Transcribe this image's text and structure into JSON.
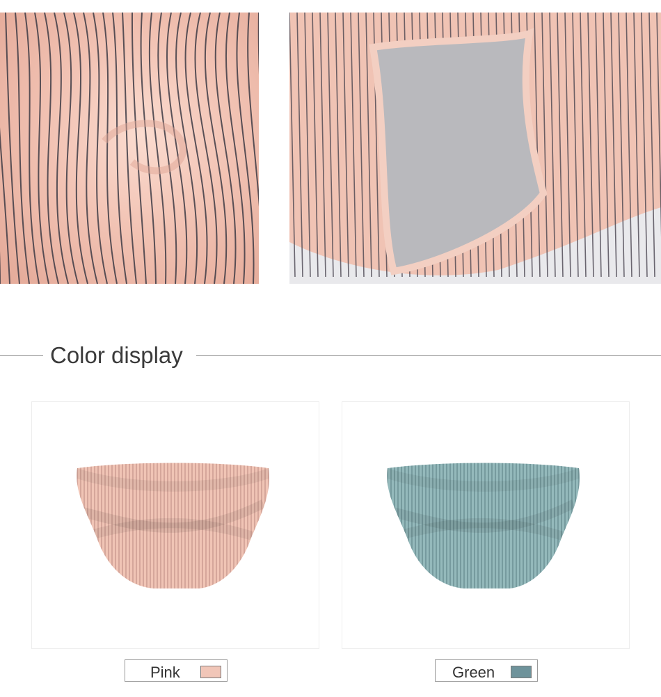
{
  "section": {
    "title": "Color display"
  },
  "colors": [
    {
      "name": "Pink",
      "swatch": "#f1c6b8",
      "fabric": "#f0c4b5",
      "stripe": "#b07f78"
    },
    {
      "name": "Green",
      "swatch": "#6e939b",
      "fabric": "#94b9bb",
      "stripe": "#4f7378"
    }
  ],
  "photos": {
    "fabric_base": "#f4cbbd",
    "fabric_stripe": "#3e3b45",
    "gusset_gray": "#b9b9bd"
  }
}
